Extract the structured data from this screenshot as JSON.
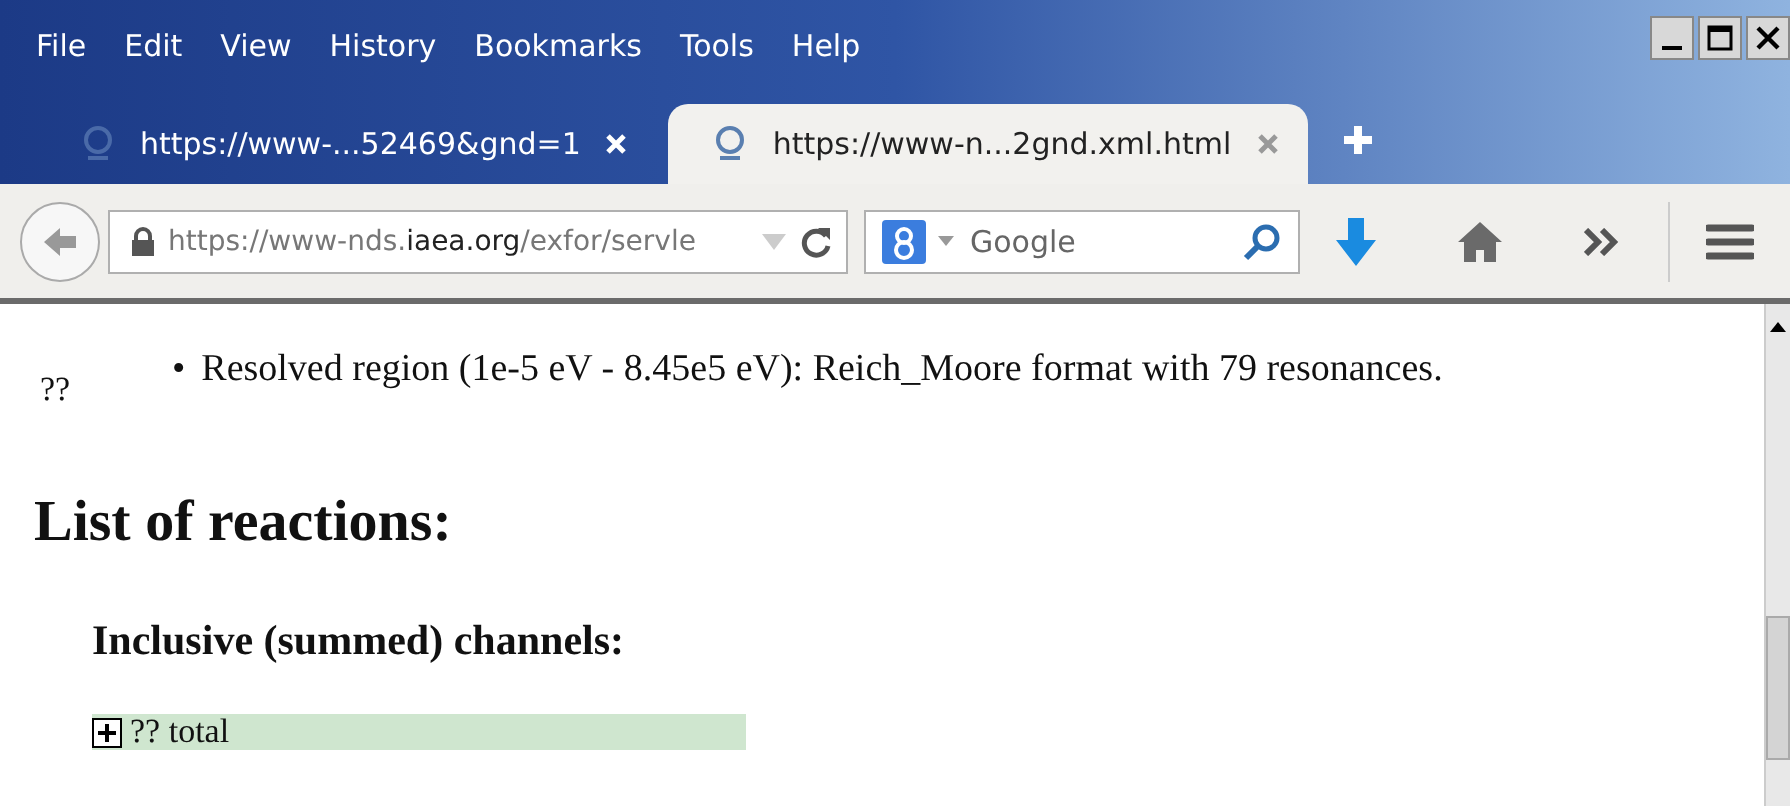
{
  "menu_bar": {
    "items": [
      {
        "label": "File"
      },
      {
        "label": "Edit"
      },
      {
        "label": "View"
      },
      {
        "label": "History"
      },
      {
        "label": "Bookmarks"
      },
      {
        "label": "Tools"
      },
      {
        "label": "Help"
      }
    ]
  },
  "tabs": [
    {
      "title": "https://www-...52469&gnd=1",
      "selected": false
    },
    {
      "title": "https://www-n...2gnd.xml.html",
      "selected": true
    }
  ],
  "nav_bar": {
    "url_parts": [
      {
        "text": "https://www-nds.",
        "kind": "dim"
      },
      {
        "text": "iaea.org",
        "kind": "domain"
      },
      {
        "text": "/exfor/servle",
        "kind": "dim"
      }
    ],
    "search": {
      "placeholder": "Google"
    }
  },
  "page": {
    "marker": "??",
    "bullets": [
      {
        "marker": "•",
        "text": "Resolved region (1e-5 eV - 8.45e5 eV): Reich_Moore format with 79 resonances."
      }
    ],
    "heading": "List of reactions:",
    "subheading": "Inclusive (summed) channels:",
    "rows": [
      {
        "label": "?? total",
        "expanded": false
      }
    ]
  }
}
